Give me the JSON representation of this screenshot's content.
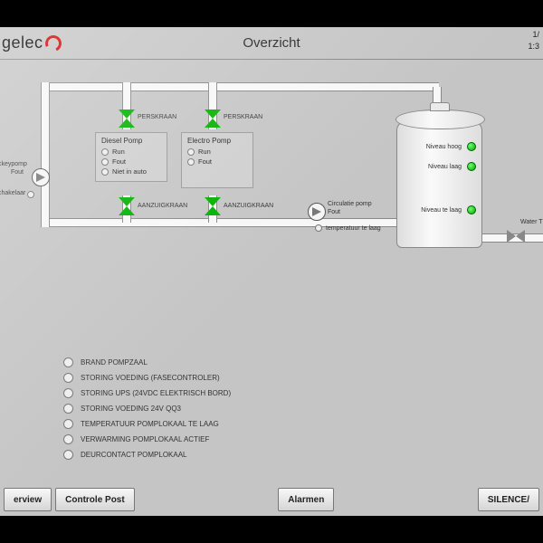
{
  "header": {
    "logo_text": "gelec",
    "title": "Overzicht",
    "date": "1/",
    "time": "1:3"
  },
  "labels": {
    "perskraan": "PERSKRAAN",
    "aanzuigkraan": "AANZUIGKRAAN",
    "jockey_pump": "ckeypomp",
    "jockey_fault": "Fout",
    "jockey_switch": "chakelaar",
    "circ_pump": "Circulatie pomp",
    "circ_fault": "Fout",
    "circ_temp": "temperatuur te laag",
    "water_t": "Water T"
  },
  "diesel": {
    "title": "Diesel Pomp",
    "run": "Run",
    "fault": "Fout",
    "notauto": "Niet in auto"
  },
  "electro": {
    "title": "Electro Pomp",
    "run": "Run",
    "fault": "Fout"
  },
  "tank": {
    "level_high": "Niveau hoog",
    "level_low": "Niveau laag",
    "level_too_low": "Niveau te laag"
  },
  "alarms": [
    "BRAND POMPZAAL",
    "STORING VOEDING (FASECONTROLER)",
    "STORING UPS (24VDC ELEKTRISCH BORD)",
    "STORING VOEDING 24V QQ3",
    "TEMPERATUUR POMPLOKAAL TE LAAG",
    "VERWARMING POMPLOKAAL ACTIEF",
    "DEURCONTACT POMPLOKAAL"
  ],
  "footer": {
    "overview": "erview",
    "controle": "Controle Post",
    "alarmen": "Alarmen",
    "silence": "SILENCE/"
  }
}
